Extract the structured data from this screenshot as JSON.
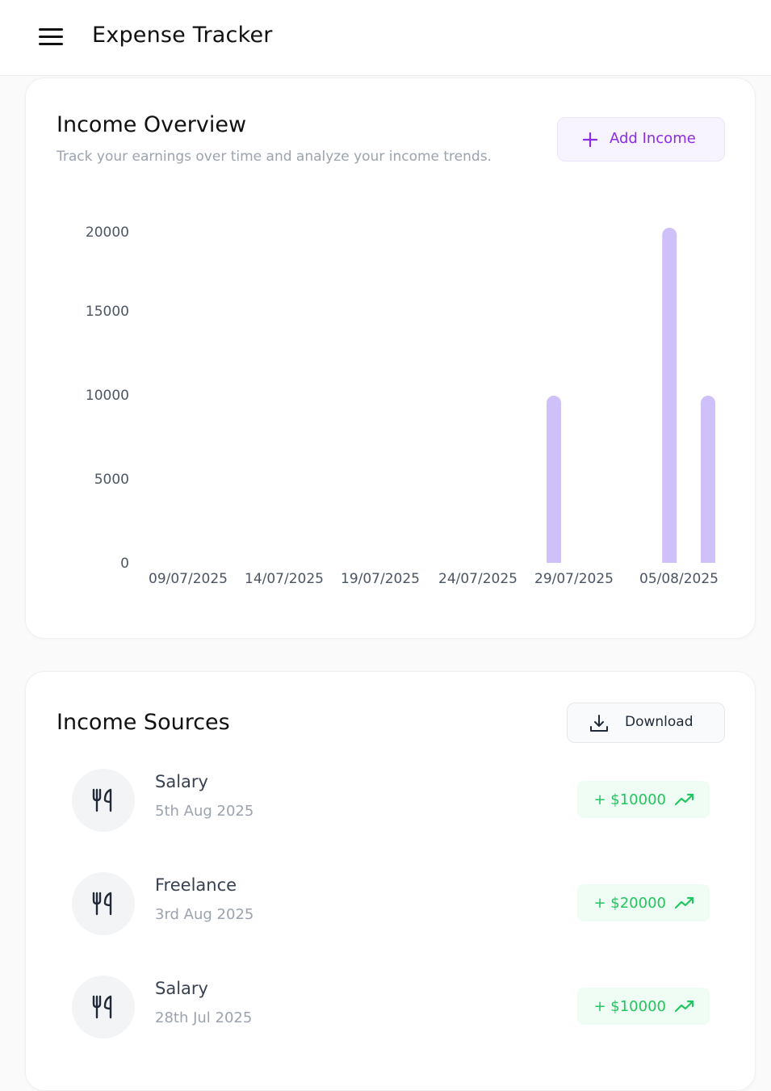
{
  "header": {
    "title": "Expense Tracker",
    "menu_icon": "hamburger-icon"
  },
  "overview": {
    "title": "Income Overview",
    "subtitle": "Track your earnings over time and analyze your income trends.",
    "add_button_label": "Add Income",
    "add_icon": "plus-icon"
  },
  "chart_data": {
    "type": "bar",
    "y_ticks": [
      "20000",
      "15000",
      "10000",
      "5000",
      "0"
    ],
    "x_tick_labels": [
      "09/07/2025",
      "14/07/2025",
      "19/07/2025",
      "24/07/2025",
      "29/07/2025",
      "05/08/2025"
    ],
    "bars": [
      {
        "x": "28/07/2025",
        "value": 10000
      },
      {
        "x": "03/08/2025",
        "value": 20000
      },
      {
        "x": "05/08/2025",
        "value": 10000
      }
    ],
    "bar_color": "#d0c0fa",
    "grid": false,
    "legend": "none"
  },
  "sources": {
    "title": "Income Sources",
    "download_label": "Download",
    "download_icon": "download-icon",
    "item_icon": "utensils-icon",
    "trend_icon": "trending-up-icon",
    "items": [
      {
        "name": "Salary",
        "date": "5th Aug 2025",
        "amount": "+ $10000"
      },
      {
        "name": "Freelance",
        "date": "3rd Aug 2025",
        "amount": "+ $20000"
      },
      {
        "name": "Salary",
        "date": "28th Jul 2025",
        "amount": "+ $10000"
      }
    ]
  },
  "colors": {
    "accent": "#8b2be2",
    "income_green": "#22c55e",
    "bar": "#d0c0fa"
  }
}
